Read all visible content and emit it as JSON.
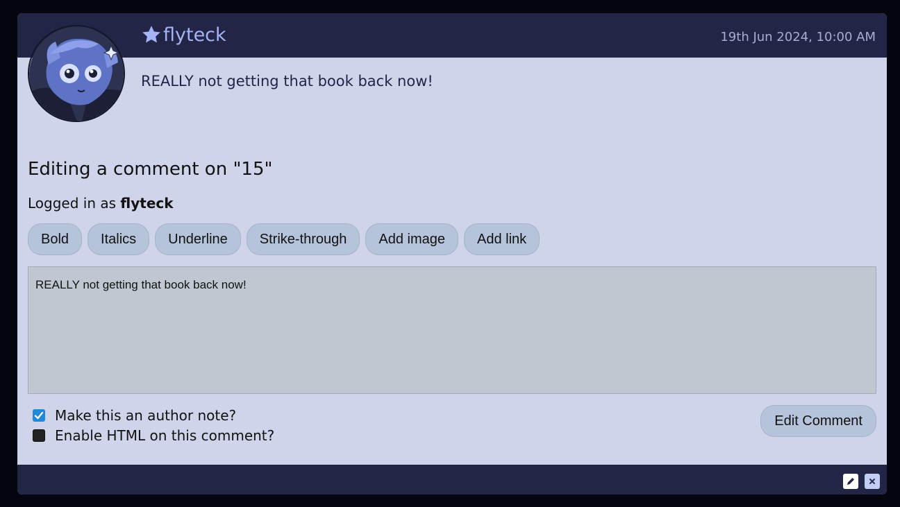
{
  "comment": {
    "author": "flyteck",
    "timestamp": "19th Jun 2024, 10:00 AM",
    "text": "REALLY not getting that book back now!"
  },
  "editor": {
    "title": "Editing a comment on \"15\"",
    "logged_in_prefix": "Logged in as ",
    "logged_in_user": "flyteck",
    "toolbar": [
      {
        "label": "Bold"
      },
      {
        "label": "Italics"
      },
      {
        "label": "Underline"
      },
      {
        "label": "Strike-through"
      },
      {
        "label": "Add image"
      },
      {
        "label": "Add link"
      }
    ],
    "textarea_value": "REALLY not getting that book back now!",
    "options": {
      "author_note": {
        "label": "Make this an author note?",
        "checked": true
      },
      "enable_html": {
        "label": "Enable HTML on this comment?",
        "checked": false
      }
    },
    "submit_label": "Edit Comment"
  },
  "footer": {
    "icons": [
      "pencil-icon",
      "close-icon"
    ]
  },
  "colors": {
    "header_bg": "#232547",
    "card_bg": "#cfd4ea",
    "author_link": "#a5b4f5",
    "button_bg": "#b5c4db",
    "textarea_bg": "#c1c7d0",
    "checkbox_checked": "#1f88d8"
  }
}
